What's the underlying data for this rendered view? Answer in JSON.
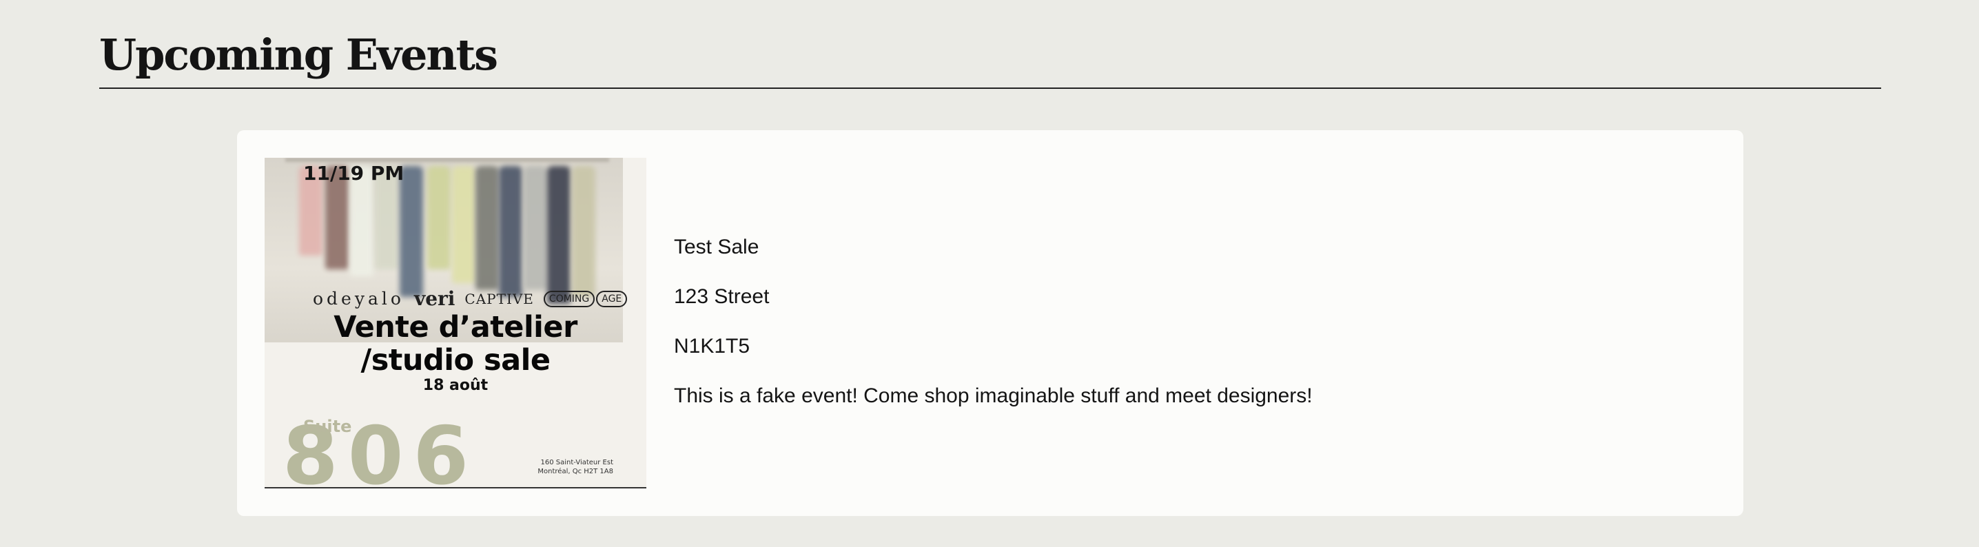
{
  "page": {
    "title": "Upcoming Events"
  },
  "events": [
    {
      "name": "Test Sale",
      "address": "123 Street",
      "postal_code": "N1K1T5",
      "description": "This is a fake event! Come shop imaginable stuff and meet designers!",
      "poster": {
        "date_time": "11/19 PM",
        "brands": [
          "odeyalo",
          "veri",
          "CAPTIVE",
          "COMING",
          "AGE"
        ],
        "headline_line1": "Vente d’atelier",
        "headline_line2": "/studio sale",
        "subline": "18 août",
        "suite_label": "Suite",
        "suite_number": "806",
        "address_line1": "160 Saint-Viateur Est",
        "address_line2": "Montréal, Qc H2T 1A8"
      }
    }
  ],
  "colors": {
    "page_background": "#ebebe6",
    "card_background": "#fcfcfa",
    "rule": "#222222",
    "poster_accent": "#b7b99d"
  }
}
